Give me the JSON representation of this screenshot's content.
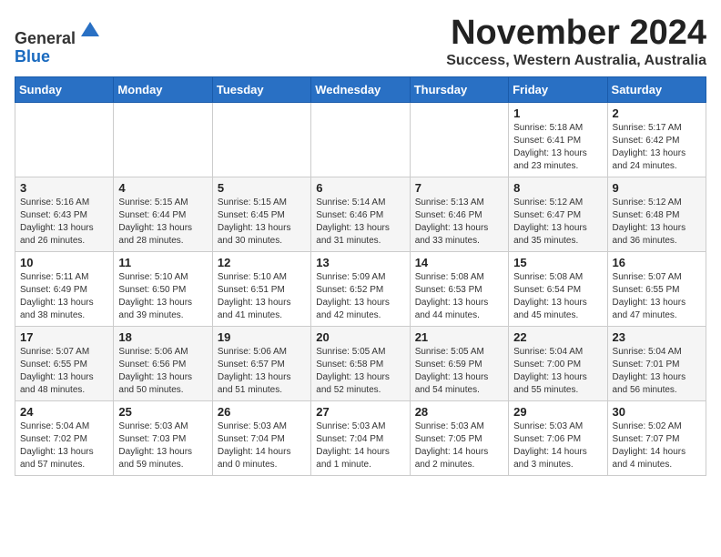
{
  "logo": {
    "general": "General",
    "blue": "Blue"
  },
  "header": {
    "month": "November 2024",
    "location": "Success, Western Australia, Australia"
  },
  "weekdays": [
    "Sunday",
    "Monday",
    "Tuesday",
    "Wednesday",
    "Thursday",
    "Friday",
    "Saturday"
  ],
  "weeks": [
    [
      {
        "day": "",
        "info": ""
      },
      {
        "day": "",
        "info": ""
      },
      {
        "day": "",
        "info": ""
      },
      {
        "day": "",
        "info": ""
      },
      {
        "day": "",
        "info": ""
      },
      {
        "day": "1",
        "info": "Sunrise: 5:18 AM\nSunset: 6:41 PM\nDaylight: 13 hours and 23 minutes."
      },
      {
        "day": "2",
        "info": "Sunrise: 5:17 AM\nSunset: 6:42 PM\nDaylight: 13 hours and 24 minutes."
      }
    ],
    [
      {
        "day": "3",
        "info": "Sunrise: 5:16 AM\nSunset: 6:43 PM\nDaylight: 13 hours and 26 minutes."
      },
      {
        "day": "4",
        "info": "Sunrise: 5:15 AM\nSunset: 6:44 PM\nDaylight: 13 hours and 28 minutes."
      },
      {
        "day": "5",
        "info": "Sunrise: 5:15 AM\nSunset: 6:45 PM\nDaylight: 13 hours and 30 minutes."
      },
      {
        "day": "6",
        "info": "Sunrise: 5:14 AM\nSunset: 6:46 PM\nDaylight: 13 hours and 31 minutes."
      },
      {
        "day": "7",
        "info": "Sunrise: 5:13 AM\nSunset: 6:46 PM\nDaylight: 13 hours and 33 minutes."
      },
      {
        "day": "8",
        "info": "Sunrise: 5:12 AM\nSunset: 6:47 PM\nDaylight: 13 hours and 35 minutes."
      },
      {
        "day": "9",
        "info": "Sunrise: 5:12 AM\nSunset: 6:48 PM\nDaylight: 13 hours and 36 minutes."
      }
    ],
    [
      {
        "day": "10",
        "info": "Sunrise: 5:11 AM\nSunset: 6:49 PM\nDaylight: 13 hours and 38 minutes."
      },
      {
        "day": "11",
        "info": "Sunrise: 5:10 AM\nSunset: 6:50 PM\nDaylight: 13 hours and 39 minutes."
      },
      {
        "day": "12",
        "info": "Sunrise: 5:10 AM\nSunset: 6:51 PM\nDaylight: 13 hours and 41 minutes."
      },
      {
        "day": "13",
        "info": "Sunrise: 5:09 AM\nSunset: 6:52 PM\nDaylight: 13 hours and 42 minutes."
      },
      {
        "day": "14",
        "info": "Sunrise: 5:08 AM\nSunset: 6:53 PM\nDaylight: 13 hours and 44 minutes."
      },
      {
        "day": "15",
        "info": "Sunrise: 5:08 AM\nSunset: 6:54 PM\nDaylight: 13 hours and 45 minutes."
      },
      {
        "day": "16",
        "info": "Sunrise: 5:07 AM\nSunset: 6:55 PM\nDaylight: 13 hours and 47 minutes."
      }
    ],
    [
      {
        "day": "17",
        "info": "Sunrise: 5:07 AM\nSunset: 6:55 PM\nDaylight: 13 hours and 48 minutes."
      },
      {
        "day": "18",
        "info": "Sunrise: 5:06 AM\nSunset: 6:56 PM\nDaylight: 13 hours and 50 minutes."
      },
      {
        "day": "19",
        "info": "Sunrise: 5:06 AM\nSunset: 6:57 PM\nDaylight: 13 hours and 51 minutes."
      },
      {
        "day": "20",
        "info": "Sunrise: 5:05 AM\nSunset: 6:58 PM\nDaylight: 13 hours and 52 minutes."
      },
      {
        "day": "21",
        "info": "Sunrise: 5:05 AM\nSunset: 6:59 PM\nDaylight: 13 hours and 54 minutes."
      },
      {
        "day": "22",
        "info": "Sunrise: 5:04 AM\nSunset: 7:00 PM\nDaylight: 13 hours and 55 minutes."
      },
      {
        "day": "23",
        "info": "Sunrise: 5:04 AM\nSunset: 7:01 PM\nDaylight: 13 hours and 56 minutes."
      }
    ],
    [
      {
        "day": "24",
        "info": "Sunrise: 5:04 AM\nSunset: 7:02 PM\nDaylight: 13 hours and 57 minutes."
      },
      {
        "day": "25",
        "info": "Sunrise: 5:03 AM\nSunset: 7:03 PM\nDaylight: 13 hours and 59 minutes."
      },
      {
        "day": "26",
        "info": "Sunrise: 5:03 AM\nSunset: 7:04 PM\nDaylight: 14 hours and 0 minutes."
      },
      {
        "day": "27",
        "info": "Sunrise: 5:03 AM\nSunset: 7:04 PM\nDaylight: 14 hours and 1 minute."
      },
      {
        "day": "28",
        "info": "Sunrise: 5:03 AM\nSunset: 7:05 PM\nDaylight: 14 hours and 2 minutes."
      },
      {
        "day": "29",
        "info": "Sunrise: 5:03 AM\nSunset: 7:06 PM\nDaylight: 14 hours and 3 minutes."
      },
      {
        "day": "30",
        "info": "Sunrise: 5:02 AM\nSunset: 7:07 PM\nDaylight: 14 hours and 4 minutes."
      }
    ]
  ]
}
